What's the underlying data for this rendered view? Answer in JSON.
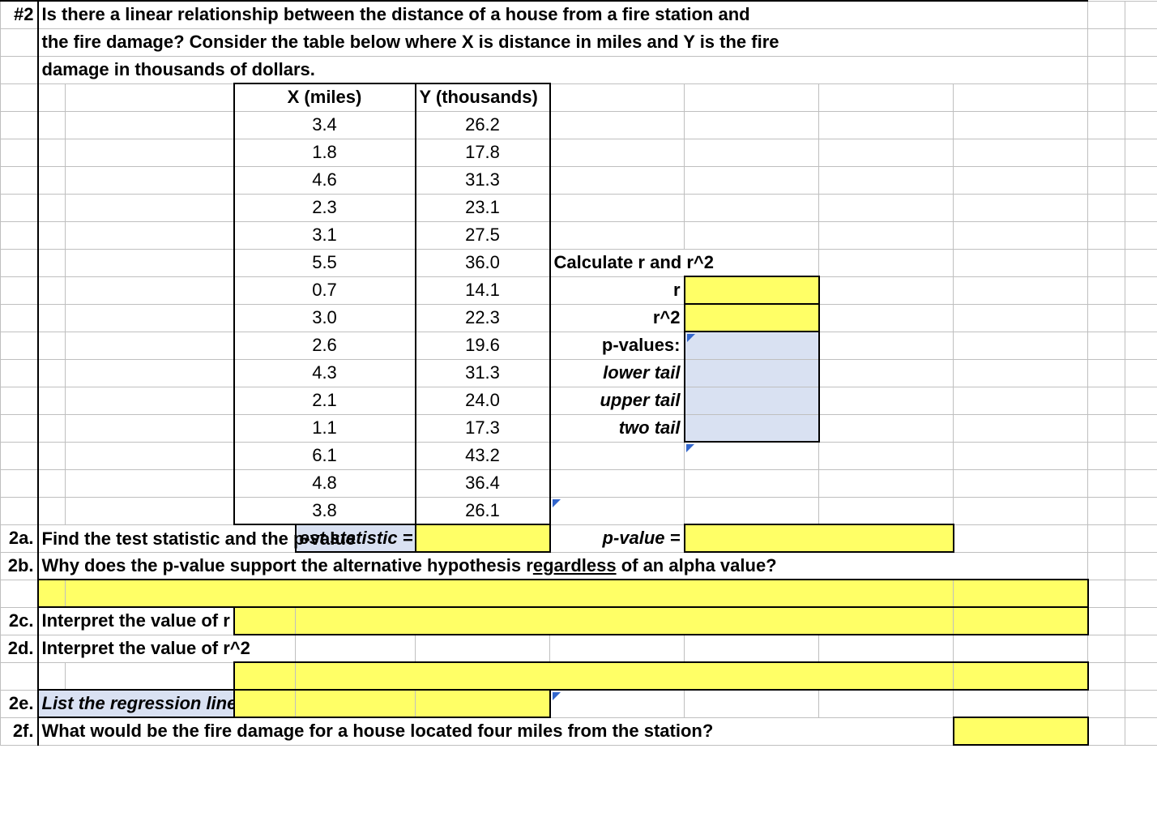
{
  "q": {
    "num": "#2",
    "line1": "Is there a linear relationship between the distance of a house from a fire station and",
    "line2": "the fire damage?  Consider the table below where X is distance in miles and Y is the fire",
    "line3": "damage in thousands of dollars."
  },
  "headers": {
    "x": "X (miles)",
    "y": "Y (thousands)"
  },
  "rows": [
    {
      "x": "3.4",
      "y": "26.2"
    },
    {
      "x": "1.8",
      "y": "17.8"
    },
    {
      "x": "4.6",
      "y": "31.3"
    },
    {
      "x": "2.3",
      "y": "23.1"
    },
    {
      "x": "3.1",
      "y": "27.5"
    },
    {
      "x": "5.5",
      "y": "36.0"
    },
    {
      "x": "0.7",
      "y": "14.1"
    },
    {
      "x": "3.0",
      "y": "22.3"
    },
    {
      "x": "2.6",
      "y": "19.6"
    },
    {
      "x": "4.3",
      "y": "31.3"
    },
    {
      "x": "2.1",
      "y": "24.0"
    },
    {
      "x": "1.1",
      "y": "17.3"
    },
    {
      "x": "6.1",
      "y": "43.2"
    },
    {
      "x": "4.8",
      "y": "36.4"
    },
    {
      "x": "3.8",
      "y": "26.1"
    }
  ],
  "calc": {
    "title": "Calculate r and r^2",
    "r": "r",
    "r2": "r^2",
    "pvalues": "p-values:",
    "lower": "lower tail",
    "upper": "upper tail",
    "two": "two tail"
  },
  "parts": {
    "a": {
      "num": "2a.",
      "text": "Find the test statistic and the p-value",
      "stat": "est statistic =",
      "pval": "p-value ="
    },
    "b": {
      "num": "2b.",
      "text_pre": "Why does the p-value support the alternative hypothesis r",
      "text_ul": "egardless",
      "text_post": " of an alpha value?"
    },
    "c": {
      "num": "2c.",
      "text": "Interpret the value of r"
    },
    "d": {
      "num": "2d.",
      "text": "Interpret the value of r^2"
    },
    "e": {
      "num": "2e.",
      "text": "List the regression line"
    },
    "f": {
      "num": "2f.",
      "text": "What would be the fire damage for a house located four miles from the station?"
    }
  }
}
